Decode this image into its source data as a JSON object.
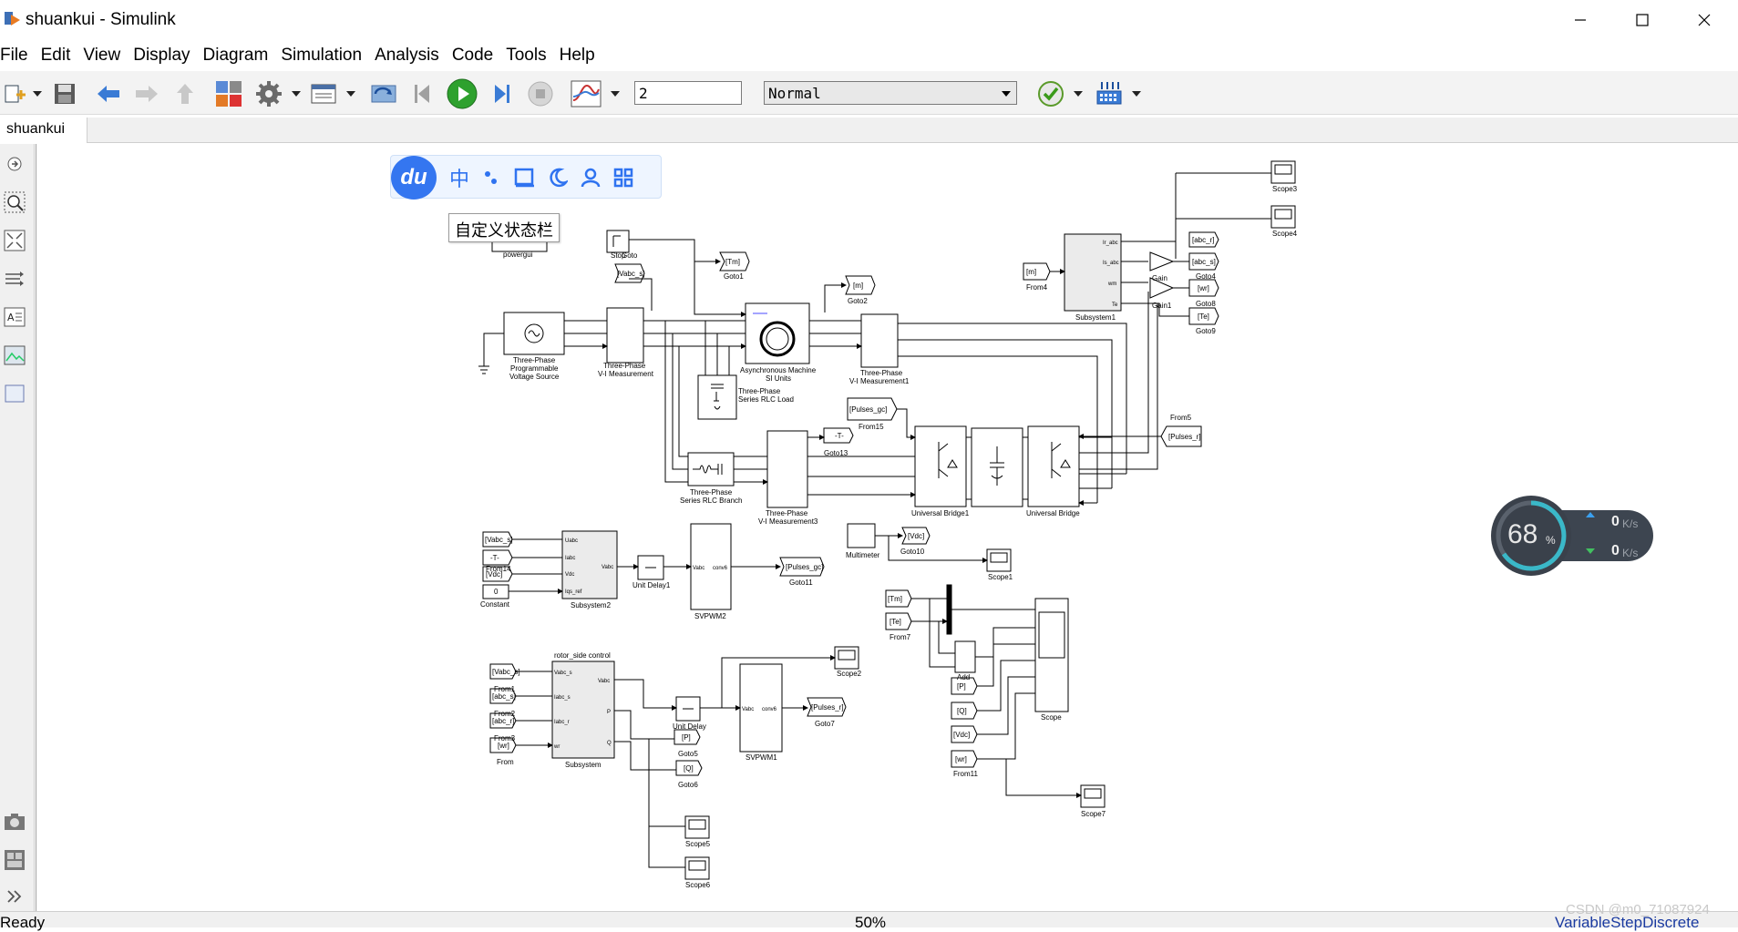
{
  "window": {
    "title": "shuankui - Simulink"
  },
  "menu": [
    "File",
    "Edit",
    "View",
    "Display",
    "Diagram",
    "Simulation",
    "Analysis",
    "Code",
    "Tools",
    "Help"
  ],
  "toolbar": {
    "stop_time": "2",
    "sim_mode": "Normal"
  },
  "tab": {
    "label": "shuankui"
  },
  "status": {
    "left": "Ready",
    "zoom": "50%",
    "solver": "VariableStepDiscrete"
  },
  "baidu": {
    "logo": "du",
    "items": [
      "中"
    ],
    "tooltip": "自定义状态栏"
  },
  "net_widget": {
    "percent": "68",
    "percent_unit": "%",
    "up": "0",
    "down": "0",
    "unit": "K/s"
  },
  "watermark": "CSDN @m0_71087924",
  "colors": {
    "toolbar_bg": "#f3f3f3",
    "run_green": "#2ea12e",
    "baidu_blue": "#3476f0",
    "widget_ring": "#3ab8c8"
  },
  "blocks": {
    "powergui": "powergui",
    "stop": "Stop",
    "goto_label": "Goto",
    "tm": "[Tm]",
    "goto1": "Goto1",
    "m": "[m]",
    "goto2": "Goto2",
    "vabc_s_goto": "[Vabc_s]",
    "source_name": [
      "Three-Phase",
      "Programmable",
      "Voltage Source"
    ],
    "vi1_name": [
      "Three-Phase",
      "V-I Measurement"
    ],
    "machine_name": [
      "Asynchronous Machine",
      "SI Units"
    ],
    "vi2_name": [
      "Three-Phase",
      "V-I Measurement1"
    ],
    "rlc_load_name": [
      "Three-Phase",
      "Series RLC Load"
    ],
    "rlc_branch_name": [
      "Three-Phase",
      "Series RLC Branch"
    ],
    "vi3_name": [
      "Three-Phase",
      "V-I Measurement3"
    ],
    "pulses_gc_from": "[Pulses_gc]",
    "from15": "From15",
    "t_goto": "-T-",
    "goto13": "Goto13",
    "ub1_name": "Universal Bridge1",
    "ub_name": "Universal Bridge",
    "from5": "From5",
    "pulses_r_from": "[Pulses_r]",
    "m_from": "[m]",
    "from4": "From4",
    "subsystem1": "Subsystem1",
    "sub1_ports": [
      "Ir_abc",
      "Is_abc",
      "wm",
      "Te"
    ],
    "gain": "Gain",
    "gain1": "Gain1",
    "abc_r": "[abc_r]",
    "abc_s": "[abc_s]",
    "wr": "[wr]",
    "te": "[Te]",
    "goto4": "Goto4",
    "goto8": "Goto8",
    "goto9": "Goto9",
    "scope3": "Scope3",
    "scope4": "Scope4",
    "multimeter": "Multimeter",
    "vdc_goto": "[Vdc]",
    "goto10": "Goto10",
    "scope1": "Scope1",
    "sub2_inputs": [
      "[Vabc_s]",
      "-T-",
      "[Vdc]",
      "0"
    ],
    "sub2_ports": [
      "Uabc",
      "Iabc",
      "Vdc",
      "Iqs_ref",
      "Vabc"
    ],
    "from14": "From14",
    "constant": "Constant",
    "subsystem2": "Subsystem2",
    "unit_delay1": "Unit Delay1",
    "svpwm2": "SVPWM2",
    "svpwm_ports": [
      "Vabc",
      "conv6"
    ],
    "pulses_gc_goto": "[Pulses_gc]",
    "goto11": "Goto11",
    "rotor_title": "rotor_side control",
    "sub_inputs": [
      "[Vabc_s]",
      "[abc_s]",
      "[abc_r]",
      "[wr]"
    ],
    "sub_ports": [
      "Vabc_s",
      "Iabc_s",
      "Iabc_r",
      "wr",
      "Vabc",
      "P",
      "Q"
    ],
    "from_labels": [
      "From1",
      "From2",
      "From3",
      "From"
    ],
    "subsystem": "Subsystem",
    "unit_delay": "Unit Delay",
    "svpwm1": "SVPWM1",
    "pulses_r_goto": "[Pulses_r]",
    "goto7": "Goto7",
    "p_goto": "[P]",
    "q_goto": "[Q]",
    "goto5": "Goto5",
    "goto6": "Goto6",
    "scope2": "Scope2",
    "scope5": "Scope5",
    "scope6": "Scope6",
    "scope_inputs": [
      "[Tm]",
      "[Te]",
      "[P]",
      "[Q]",
      "[Vdc]",
      "[wr]"
    ],
    "from7": "From7",
    "from11": "From11",
    "add": "Add",
    "scope": "Scope",
    "scope7": "Scope7"
  }
}
